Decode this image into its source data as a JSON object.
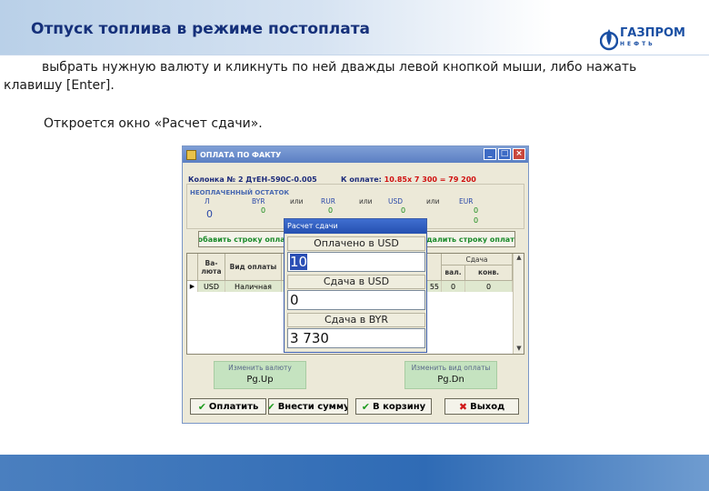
{
  "slide": {
    "title": "Отпуск топлива в режиме постоплата",
    "body_line1": "выбрать нужную валюту и кликнуть по ней дважды левой кнопкой мыши, либо нажать",
    "body_line2": "клавишу [Enter].",
    "body_line3": "Откроется окно «Расчет сдачи».",
    "logo_main": "ГАЗПРОМ",
    "logo_sub": "НЕФТЬ",
    "colors": {
      "title": "#15307a",
      "band": "#2f6bb5"
    }
  },
  "window": {
    "title": "ОПЛАТА ПО ФАКТУ",
    "controls": {
      "minimize": "_",
      "maximize": "□",
      "close": "×"
    },
    "info": "Колонка № 2 ДтЕН-590С-0.005",
    "pay_label": "К оплате:",
    "pay_value": "10.85х  7 300 =  79 200",
    "remainder_label": "НЕОПЛАЧЕННЫЙ ОСТАТОК",
    "currencies": {
      "l": "Л",
      "l_val": "0",
      "byr": "BYR",
      "byr_val": "0",
      "or1": "или",
      "rur": "RUR",
      "rur_val": "0",
      "or2": "или",
      "usd": "USD",
      "usd_val": "0",
      "or3": "или",
      "eur": "EUR",
      "eur_val1": "0",
      "eur_val2": "0"
    },
    "add_row_label": "Добавить строку оплаты",
    "delete_row_label": "Удалить строку оплаты",
    "grid": {
      "headers": {
        "currency": "Ва-\nлюта",
        "pay_type": "Вид оплаты",
        "rate": "вал.",
        "conv": "конв."
      },
      "header_change": "Сдача",
      "row": {
        "marker": "▶",
        "currency": "USD",
        "pay_type": "Наличная",
        "amount": "55",
        "rate": "0",
        "conv": "0"
      }
    },
    "hints": {
      "change_currency": "Изменить валюту",
      "change_currency_key": "Pg.Up",
      "change_pay_type": "Изменить вид оплаты",
      "change_pay_type_key": "Pg.Dn"
    },
    "buttons": {
      "pay": "Оплатить",
      "enter_sum": "Внести сумму",
      "to_cart": "В корзину",
      "exit": "Выход"
    }
  },
  "change_dialog": {
    "title": "Расчет сдачи",
    "paid_label": "Оплачено в USD",
    "paid_value": "10",
    "change_usd_label": "Сдача в USD",
    "change_usd_value": "0",
    "change_byr_label": "Сдача в BYR",
    "change_byr_value": "3 730"
  }
}
